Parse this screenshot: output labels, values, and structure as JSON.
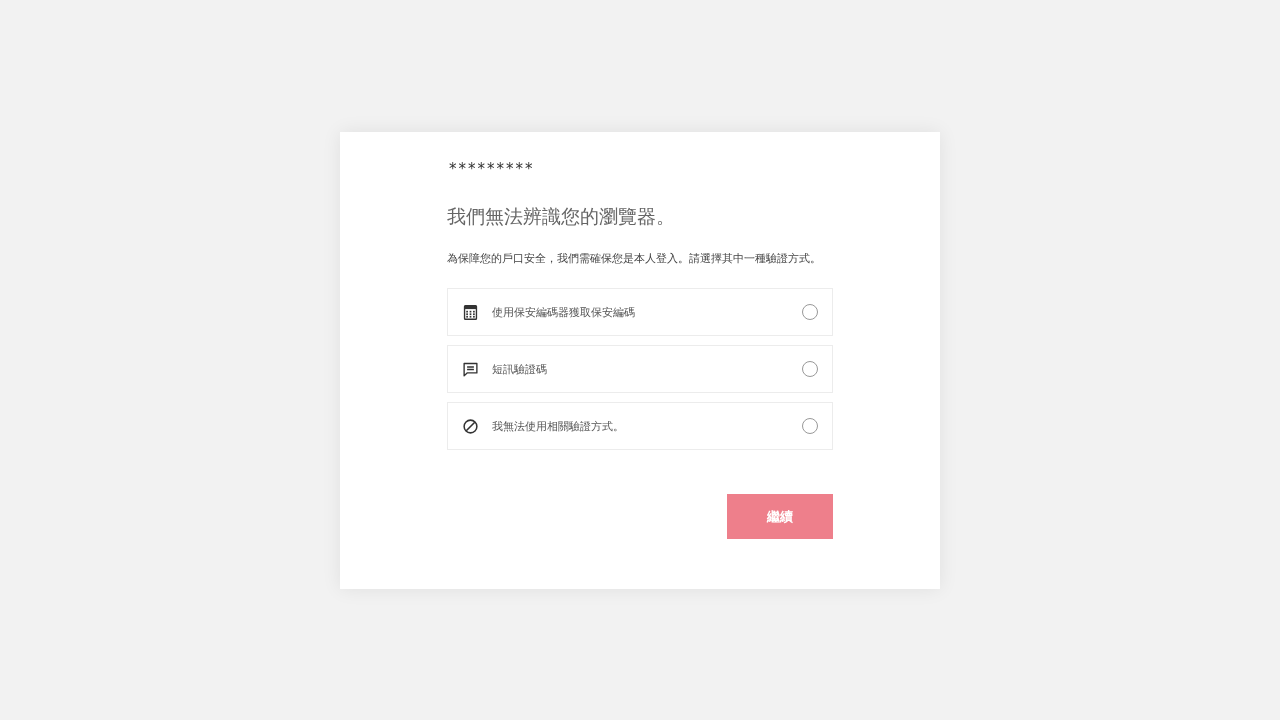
{
  "masked_account": "*********",
  "heading": "我們無法辨識您的瀏覽器。",
  "description": "為保障您的戶口安全，我們需確保您是本人登入。請選擇其中一種驗證方式。",
  "options": [
    {
      "kind": "token",
      "label": "使用保安編碼器獲取保安編碼",
      "selected": false
    },
    {
      "kind": "sms",
      "label": "短訊驗證碼",
      "selected": false
    },
    {
      "kind": "unavailable",
      "label": "我無法使用相關驗證方式。",
      "selected": false
    }
  ],
  "continue_button": {
    "label": "繼續"
  }
}
